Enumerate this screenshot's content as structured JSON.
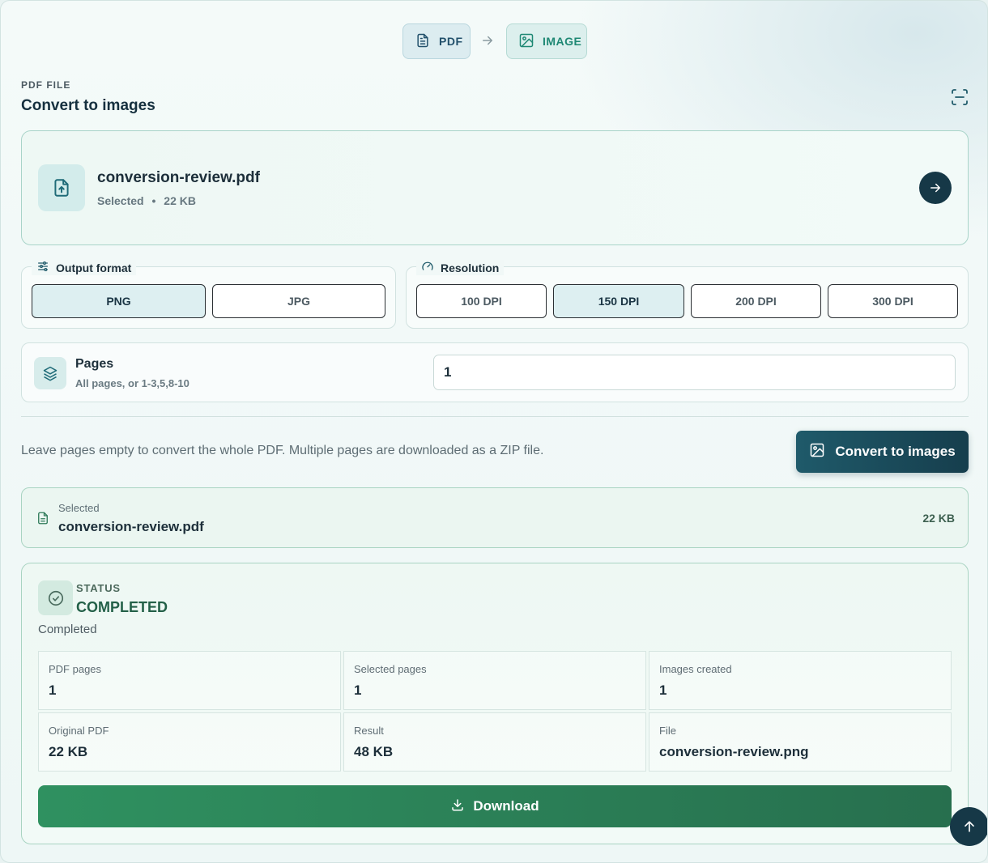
{
  "header": {
    "source_format": "PDF",
    "target_format": "IMAGE",
    "eyebrow": "PDF FILE",
    "title": "Convert to images"
  },
  "file": {
    "name": "conversion-review.pdf",
    "state": "Selected",
    "separator": "•",
    "size": "22 KB"
  },
  "output_format": {
    "label": "Output format",
    "options": [
      "PNG",
      "JPG"
    ],
    "selected": "PNG"
  },
  "resolution": {
    "label": "Resolution",
    "options": [
      "100 DPI",
      "150 DPI",
      "200 DPI",
      "300 DPI"
    ],
    "selected": "150 DPI"
  },
  "pages": {
    "label": "Pages",
    "hint": "All pages, or 1-3,5,8-10",
    "value": "1"
  },
  "note": "Leave pages empty to convert the whole PDF. Multiple pages are downloaded as a ZIP file.",
  "convert_button": "Convert to images",
  "selected_summary": {
    "label": "Selected",
    "name": "conversion-review.pdf",
    "size": "22 KB"
  },
  "status": {
    "eyebrow": "STATUS",
    "value": "COMPLETED",
    "text": "Completed",
    "stats": [
      {
        "label": "PDF pages",
        "value": "1"
      },
      {
        "label": "Selected pages",
        "value": "1"
      },
      {
        "label": "Images created",
        "value": "1"
      },
      {
        "label": "Original PDF",
        "value": "22 KB"
      },
      {
        "label": "Result",
        "value": "48 KB"
      },
      {
        "label": "File",
        "value": "conversion-review.png"
      }
    ],
    "download_label": "Download"
  },
  "colors": {
    "primary_dark": "#163847",
    "accent_teal": "#1f8874",
    "success_green": "#2f9160"
  },
  "icons": [
    "document-icon",
    "image-icon",
    "arrow-right-icon",
    "scan-icon",
    "upload-file-icon",
    "sliders-icon",
    "gauge-icon",
    "layers-icon",
    "check-circle-icon",
    "download-icon",
    "arrow-up-icon"
  ]
}
